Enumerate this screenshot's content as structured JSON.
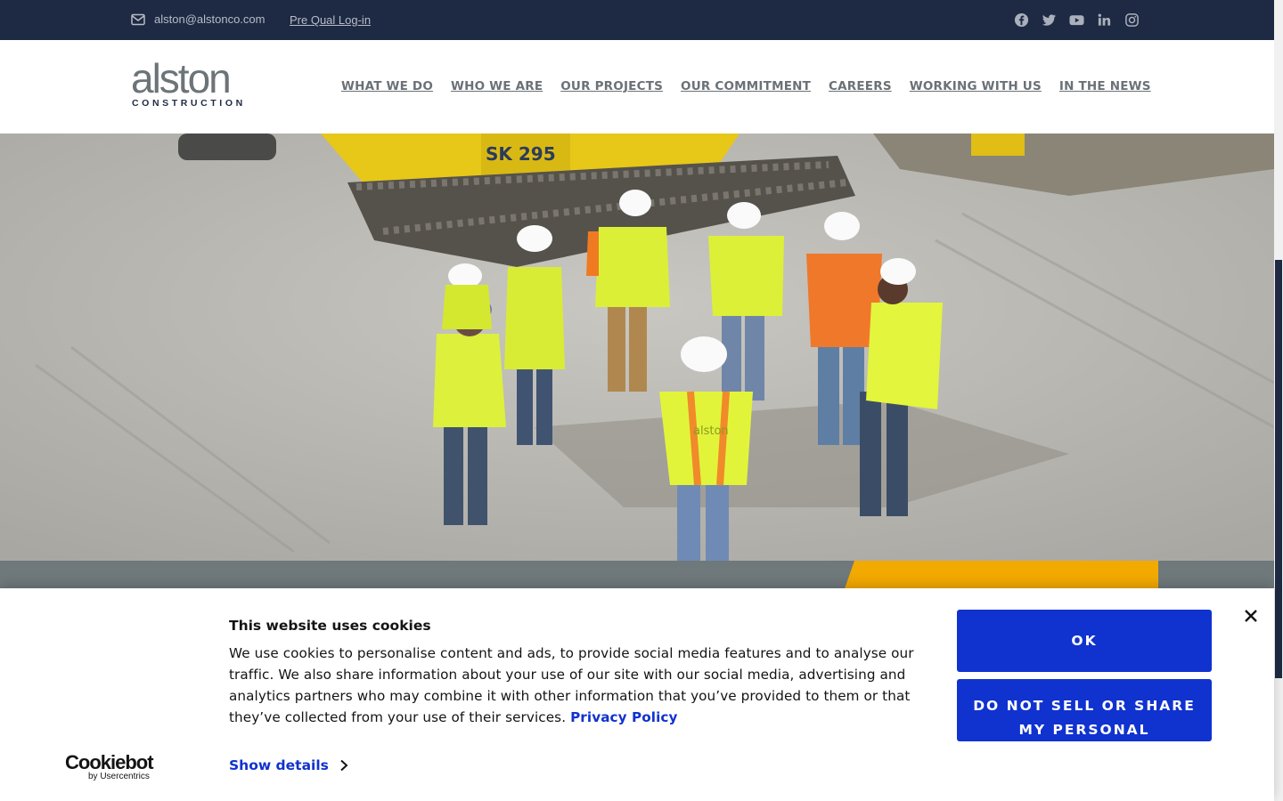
{
  "topbar": {
    "email": "alston@alstonco.com",
    "prequal_label": "Pre Qual Log-in",
    "social_icons": [
      "facebook-icon",
      "twitter-icon",
      "youtube-icon",
      "linkedin-icon",
      "instagram-icon"
    ]
  },
  "header": {
    "logo_word": "alston",
    "logo_sub": "CONSTRUCTION",
    "nav": [
      "WHAT WE DO",
      "WHO WE ARE",
      "OUR PROJECTS",
      "OUR COMMITMENT",
      "CAREERS",
      "WORKING WITH US",
      "IN THE NEWS"
    ]
  },
  "hero": {
    "vest_logo": "alston",
    "machine_label": "SK 295"
  },
  "cookie": {
    "title": "This website uses cookies",
    "body": "We use cookies to personalise content and ads, to provide social media features and to analyse our traffic. We also share information about your use of our site with our social media, advertising and analytics partners who may combine it with other information that you’ve provided to them or that they’ve collected from your use of their services.",
    "privacy_link": "Privacy Policy",
    "show_details": "Show details",
    "ok_label": "OK",
    "dns_label": "DO NOT SELL OR SHARE MY PERSONAL INFORMATION",
    "brand": "Cookiebot",
    "brand_sub": "by Usercentrics"
  },
  "colors": {
    "topbar": "#1e2a44",
    "accent_yellow": "#f2a900",
    "cookie_blue": "#1032cf",
    "band_gray": "#6f787b"
  }
}
